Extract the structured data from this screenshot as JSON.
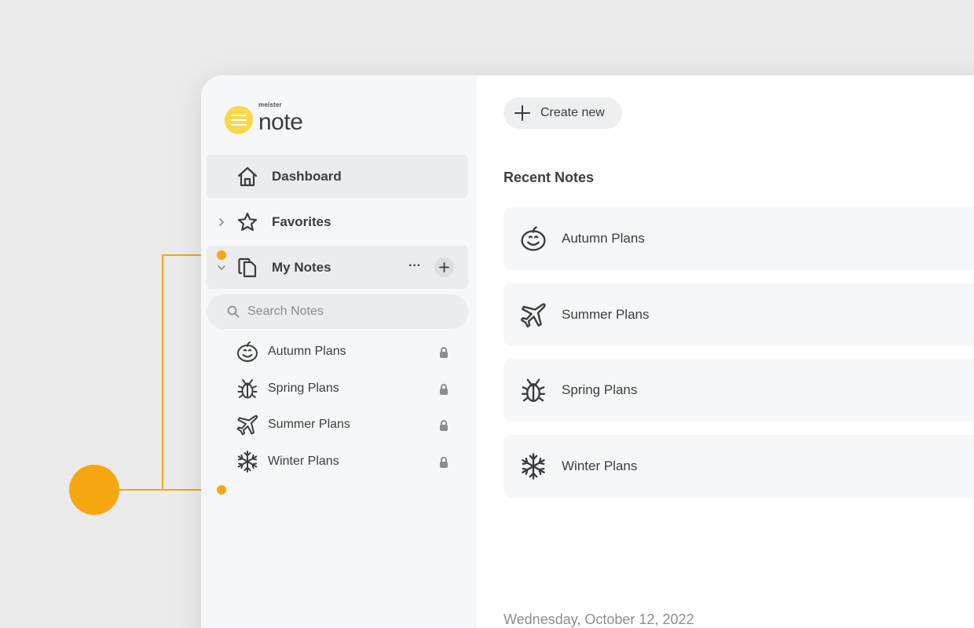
{
  "logo": {
    "small": "meister",
    "big": "note"
  },
  "nav": [
    {
      "label": "Dashboard",
      "icon": "home-icon"
    },
    {
      "label": "Favorites",
      "icon": "star-icon"
    },
    {
      "label": "My Notes",
      "icon": "notes-icon",
      "more": "···"
    }
  ],
  "search": {
    "placeholder": "Search Notes"
  },
  "sidebar_notes": [
    {
      "label": "Autumn Plans",
      "icon": "pumpkin-icon"
    },
    {
      "label": "Spring Plans",
      "icon": "bug-icon"
    },
    {
      "label": "Summer Plans",
      "icon": "airplane-icon"
    },
    {
      "label": "Winter Plans",
      "icon": "snowflake-icon"
    }
  ],
  "main": {
    "create_label": "Create new",
    "section_title": "Recent Notes",
    "recent": [
      {
        "label": "Autumn Plans",
        "icon": "pumpkin-icon"
      },
      {
        "label": "Summer Plans",
        "icon": "airplane-icon"
      },
      {
        "label": "Spring Plans",
        "icon": "bug-icon"
      },
      {
        "label": "Winter Plans",
        "icon": "snowflake-icon"
      }
    ],
    "date": "Wednesday, October 12, 2022"
  },
  "colors": {
    "accent": "#f7a711",
    "logo": "#fdd74b",
    "sidebar_bg": "#f6f7f8",
    "active_bg": "#ebecee"
  }
}
